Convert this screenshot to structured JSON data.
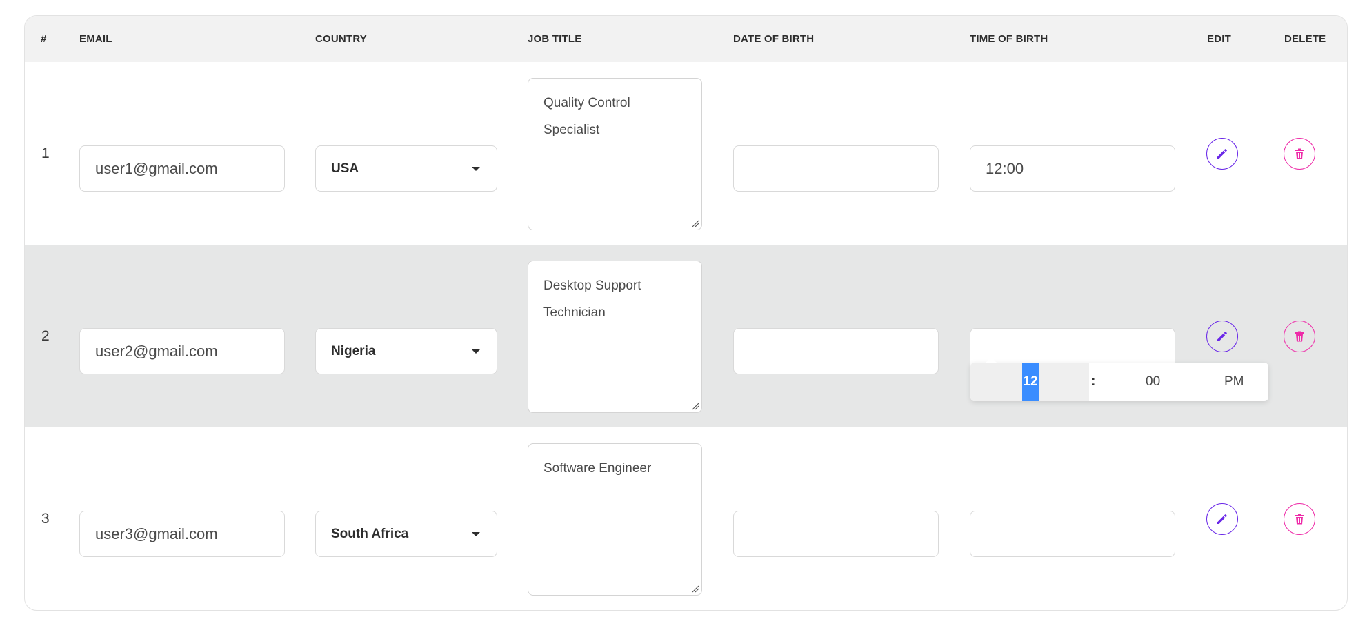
{
  "table": {
    "headers": {
      "num": "#",
      "email": "EMAIL",
      "country": "COUNTRY",
      "job_title": "JOB TITLE",
      "dob": "DATE OF BIRTH",
      "tob": "TIME OF BIRTH",
      "edit": "EDIT",
      "delete": "DELETE"
    },
    "rows": [
      {
        "num": "1",
        "email": "user1@gmail.com",
        "country": "USA",
        "job_title": "Quality Control Specialist",
        "dob": "",
        "tob": "12:00"
      },
      {
        "num": "2",
        "email": "user2@gmail.com",
        "country": "Nigeria",
        "job_title": "Desktop Support Technician",
        "dob": "",
        "tob": ""
      },
      {
        "num": "3",
        "email": "user3@gmail.com",
        "country": "South Africa",
        "job_title": "Software Engineer",
        "dob": "",
        "tob": ""
      }
    ]
  },
  "time_picker": {
    "hour": "12",
    "separator": ":",
    "minute": "00",
    "ampm": "PM"
  },
  "colors": {
    "header_bg": "#f2f2f2",
    "alt_row_bg": "#e6e7e7",
    "edit_accent": "#6a28e8",
    "delete_accent": "#ee2ba8",
    "picker_highlight": "#3a8dff"
  },
  "icons": {
    "edit": "pencil-icon",
    "delete": "trash-icon",
    "dropdown": "caret-down-icon"
  }
}
